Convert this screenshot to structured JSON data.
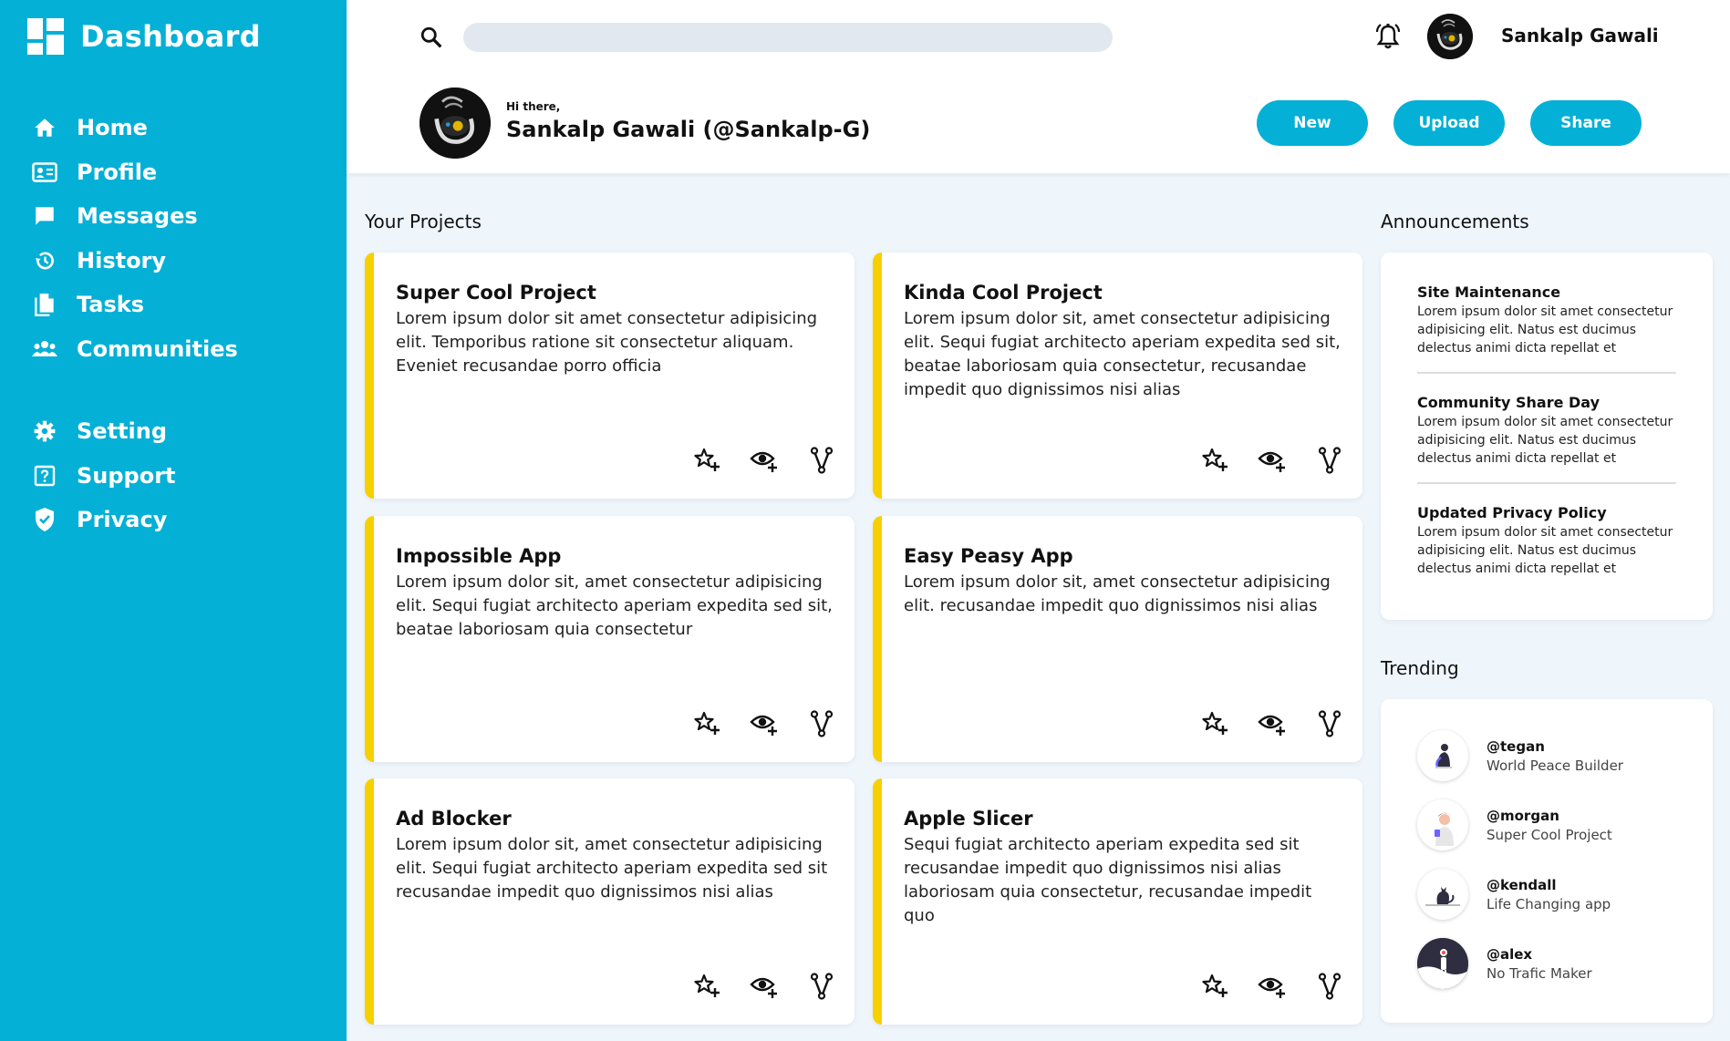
{
  "sidebar": {
    "title": "Dashboard",
    "items": [
      {
        "label": "Home",
        "icon": "home-icon"
      },
      {
        "label": "Profile",
        "icon": "profile-card-icon"
      },
      {
        "label": "Messages",
        "icon": "chat-bubble-icon"
      },
      {
        "label": "History",
        "icon": "history-icon"
      },
      {
        "label": "Tasks",
        "icon": "document-icon"
      },
      {
        "label": "Communities",
        "icon": "people-group-icon"
      }
    ],
    "items2": [
      {
        "label": "Setting",
        "icon": "gear-icon"
      },
      {
        "label": "Support",
        "icon": "help-icon"
      },
      {
        "label": "Privacy",
        "icon": "shield-icon"
      }
    ]
  },
  "header": {
    "search_placeholder": "",
    "user_name": "Sankalp Gawali",
    "greeting": "Hi there,",
    "user_full": "Sankalp Gawali (@Sankalp-G)",
    "buttons": {
      "new": "New",
      "upload": "Upload",
      "share": "Share"
    }
  },
  "projects": {
    "title": "Your Projects",
    "items": [
      {
        "title": "Super Cool Project",
        "desc": "Lorem ipsum dolor sit amet consectetur adipisicing elit. Temporibus ratione sit consectetur aliquam. Eveniet recusandae porro officia"
      },
      {
        "title": "Kinda Cool Project",
        "desc": "Lorem ipsum dolor sit, amet consectetur adipisicing elit. Sequi fugiat architecto aperiam expedita sed sit, beatae laboriosam quia consectetur, recusandae impedit quo dignissimos nisi alias"
      },
      {
        "title": "Impossible App",
        "desc": "Lorem ipsum dolor sit, amet consectetur adipisicing elit. Sequi fugiat architecto aperiam expedita sed sit, beatae laboriosam quia consectetur"
      },
      {
        "title": "Easy Peasy App",
        "desc": "Lorem ipsum dolor sit, amet consectetur adipisicing elit. recusandae impedit quo dignissimos nisi alias"
      },
      {
        "title": "Ad Blocker",
        "desc": "Lorem ipsum dolor sit, amet consectetur adipisicing elit. Sequi fugiat architecto aperiam expedita sed sit recusandae impedit quo dignissimos nisi alias"
      },
      {
        "title": "Apple Slicer",
        "desc": "Sequi fugiat architecto aperiam expedita sed sit recusandae impedit quo dignissimos nisi alias laboriosam quia consectetur, recusandae impedit quo"
      }
    ]
  },
  "announcements": {
    "title": "Announcements",
    "items": [
      {
        "title": "Site Maintenance",
        "body": "Lorem ipsum dolor sit amet consectetur adipisicing elit. Natus est ducimus delectus animi dicta repellat et"
      },
      {
        "title": "Community Share Day",
        "body": "Lorem ipsum dolor sit amet consectetur adipisicing elit. Natus est ducimus delectus animi dicta repellat et"
      },
      {
        "title": "Updated Privacy Policy",
        "body": "Lorem ipsum dolor sit amet consectetur adipisicing elit. Natus est ducimus delectus animi dicta repellat et"
      }
    ]
  },
  "trending": {
    "title": "Trending",
    "items": [
      {
        "handle": "@tegan",
        "desc": "World Peace Builder"
      },
      {
        "handle": "@morgan",
        "desc": "Super Cool Project"
      },
      {
        "handle": "@kendall",
        "desc": "Life Changing app"
      },
      {
        "handle": "@alex",
        "desc": "No Trafic Maker"
      }
    ]
  },
  "colors": {
    "accent": "#04b0d6",
    "card_stripe": "#f7d000",
    "background": "#eef5fb"
  }
}
